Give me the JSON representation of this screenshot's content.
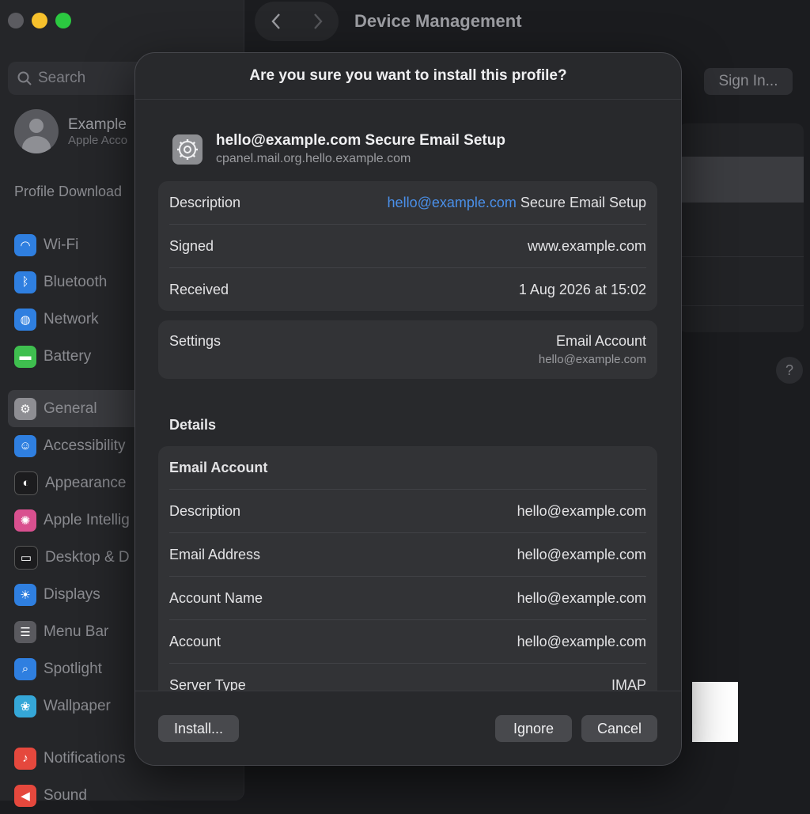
{
  "window": {
    "title": "Device Management",
    "sign_in_label": "Sign In...",
    "help_label": "?"
  },
  "sidebar": {
    "search_placeholder": "Search",
    "account_name": "Example",
    "account_sub": "Apple Acco",
    "section_label": "Profile Download",
    "items": [
      {
        "label": "Wi-Fi",
        "icon": "wifi-icon",
        "color": "#2f7fe0"
      },
      {
        "label": "Bluetooth",
        "icon": "bluetooth-icon",
        "color": "#2f7fe0"
      },
      {
        "label": "Network",
        "icon": "globe-icon",
        "color": "#2f7fe0"
      },
      {
        "label": "Battery",
        "icon": "battery-icon",
        "color": "#3fbf4f"
      },
      {
        "label": "General",
        "icon": "gear-icon",
        "color": "#8e8e93"
      },
      {
        "label": "Accessibility",
        "icon": "accessibility-icon",
        "color": "#2f7fe0"
      },
      {
        "label": "Appearance",
        "icon": "appearance-icon",
        "color": "#1c1c1e"
      },
      {
        "label": "Apple Intellig",
        "icon": "apple-intelligence-icon",
        "color": "#d9508f"
      },
      {
        "label": "Desktop & D",
        "icon": "desktop-icon",
        "color": "#1c1c1e"
      },
      {
        "label": "Displays",
        "icon": "sun-icon",
        "color": "#2f7fe0"
      },
      {
        "label": "Menu Bar",
        "icon": "menubar-icon",
        "color": "#5a5a5f"
      },
      {
        "label": "Spotlight",
        "icon": "magnifier-icon",
        "color": "#2f7fe0"
      },
      {
        "label": "Wallpaper",
        "icon": "wallpaper-icon",
        "color": "#35a7d8"
      },
      {
        "label": "Notifications",
        "icon": "bell-icon",
        "color": "#e5483d"
      },
      {
        "label": "Sound",
        "icon": "speaker-icon",
        "color": "#e5483d"
      }
    ]
  },
  "dialog": {
    "title": "Are you sure you want to install this profile?",
    "profile_name": "hello@example.com Secure Email Setup",
    "profile_id": "cpanel.mail.org.hello.example.com",
    "summary": {
      "description_label": "Description",
      "description_link": "hello@example.com",
      "description_rest": " Secure Email Setup",
      "signed_label": "Signed",
      "signed_value": "www.example.com",
      "received_label": "Received",
      "received_value": "1 Aug 2026 at 15:02"
    },
    "settings": {
      "label": "Settings",
      "value": "Email Account",
      "sub": "hello@example.com"
    },
    "details_heading": "Details",
    "details": {
      "section_title": "Email Account",
      "rows": [
        {
          "label": "Description",
          "value": "hello@example.com"
        },
        {
          "label": "Email Address",
          "value": "hello@example.com"
        },
        {
          "label": "Account Name",
          "value": "hello@example.com"
        },
        {
          "label": "Account",
          "value": "hello@example.com"
        },
        {
          "label": "Server Type",
          "value": "IMAP"
        }
      ]
    },
    "buttons": {
      "install": "Install...",
      "ignore": "Ignore",
      "cancel": "Cancel"
    }
  }
}
